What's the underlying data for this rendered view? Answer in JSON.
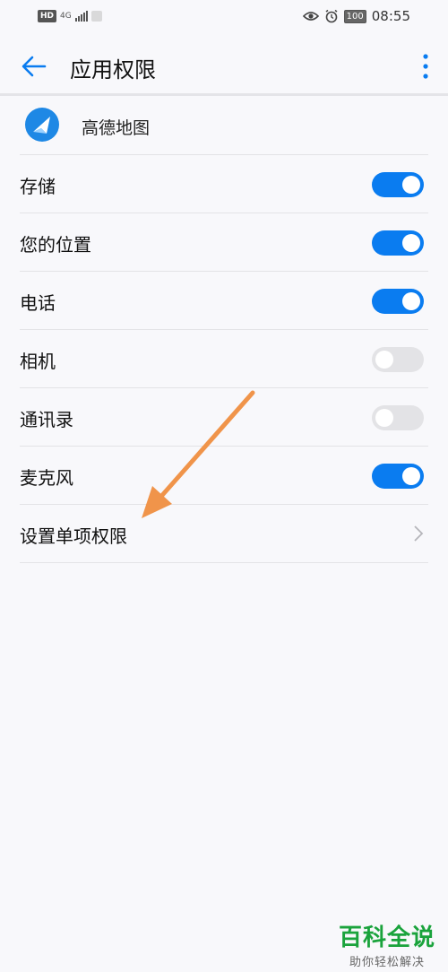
{
  "status_bar": {
    "hd": "HD",
    "network": "4G",
    "time": "08:55",
    "battery": "100"
  },
  "header": {
    "title": "应用权限"
  },
  "app": {
    "name": "高德地图"
  },
  "permissions": [
    {
      "label": "存储",
      "enabled": true
    },
    {
      "label": "您的位置",
      "enabled": true
    },
    {
      "label": "电话",
      "enabled": true
    },
    {
      "label": "相机",
      "enabled": false
    },
    {
      "label": "通讯录",
      "enabled": false
    },
    {
      "label": "麦克风",
      "enabled": true
    }
  ],
  "single_permission": {
    "label": "设置单项权限"
  },
  "watermark": {
    "title": "百科全说",
    "subtitle": "助你轻松解决"
  },
  "colors": {
    "accent": "#0a7cf0",
    "annotation_arrow": "#f0944a",
    "watermark_green": "#1aa33c"
  }
}
